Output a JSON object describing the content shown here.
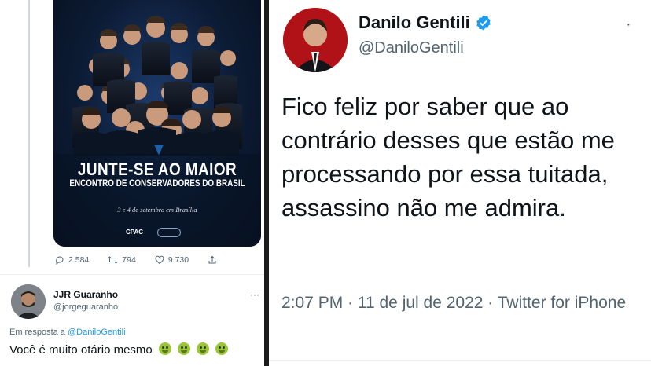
{
  "left_tweet": {
    "poster": {
      "headline": "JUNTE-SE AO MAIOR",
      "subheadline": "ENCONTRO DE CONSERVADORES DO BRASIL",
      "date_line": "3 e 4 de setembro em Brasília",
      "logo_text": "CPAC"
    },
    "actions": {
      "replies": "2.584",
      "retweets": "794",
      "likes": "9.730"
    }
  },
  "reply": {
    "name": "JJR Guaranho",
    "handle": "@jorgeguaranho",
    "more": "···",
    "reply_prefix": "Em resposta a",
    "reply_mention": "@DaniloGentili",
    "text": "Você é muito otário mesmo"
  },
  "main_tweet": {
    "author_name": "Danilo Gentili",
    "author_handle": "@DaniloGentili",
    "more": "·",
    "text": "Fico feliz por saber que ao contrário desses que estão me processando por essa tuitada, assassino não me admira.",
    "meta": "2:07 PM · 11 de jul de 2022 · Twitter for iPhone"
  },
  "colors": {
    "accent": "#1d9bf0",
    "secondary_text": "#536471",
    "poster_bg": "#0c1b34",
    "avatar_bg": "#b01218"
  },
  "icons": {
    "reply": "reply-icon",
    "retweet": "retweet-icon",
    "like": "heart-icon",
    "share": "share-icon",
    "verified": "verified-badge-icon"
  }
}
